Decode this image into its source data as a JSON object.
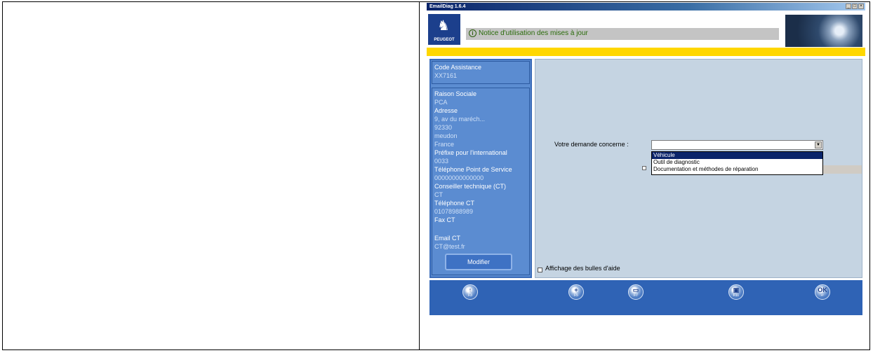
{
  "window": {
    "title": "EmailDiag 1.6.4",
    "controls": [
      "_",
      "□",
      "×"
    ]
  },
  "brand": {
    "logo_text": "PEUGEOT",
    "logo_icon": "peugeot-lion-icon"
  },
  "notice": {
    "icon": "info-icon",
    "icon_glyph": "i",
    "text": "Notice d'utilisation des mises à jour"
  },
  "sidebar": {
    "code_label": "Code Assistance",
    "code_value": "XX7161",
    "fields": [
      {
        "label": "Raison Sociale",
        "value": "PCA"
      },
      {
        "label": "Adresse",
        "value": "9, av du maréch..."
      },
      {
        "label": "",
        "value": "92330"
      },
      {
        "label": "",
        "value": "meudon"
      },
      {
        "label": "",
        "value": "France"
      },
      {
        "label": "Préfixe pour l'international",
        "value": "0033"
      },
      {
        "label": "Téléphone Point de Service",
        "value": "00000000000000"
      },
      {
        "label": "Conseiller technique (CT)",
        "value": "CT"
      },
      {
        "label": "Téléphone CT",
        "value": "01078988989"
      },
      {
        "label": "Fax CT",
        "value": ""
      },
      {
        "label": "Email CT",
        "value": "CT@test.fr"
      }
    ],
    "modify_button": "Modifier"
  },
  "form": {
    "request_label": "Votre demande concerne :",
    "select_value": "",
    "dropdown_options": [
      "Véhicule",
      "Outil de diagnostic",
      "Documentation et méthodes de réparation"
    ],
    "selected_index": 0,
    "help_checkbox_label": "Affichage des bulles d'aide",
    "help_checked": false
  },
  "toolbar": {
    "buttons": [
      {
        "icon": "upload-icon",
        "glyph": "↑",
        "key": "F3"
      },
      {
        "icon": "add-icon",
        "glyph": "+",
        "key": "F5"
      },
      {
        "icon": "attach-icon",
        "glyph": "▭",
        "key": "F7"
      },
      {
        "icon": "monitor-icon",
        "glyph": "▣",
        "key": "F11"
      },
      {
        "icon": "ok-icon",
        "glyph": "OK",
        "key": "↵"
      }
    ]
  },
  "colors": {
    "panel_blue": "#5b8cd1",
    "toolbar_blue": "#2f63b5",
    "banner_yellow": "#ffd700",
    "notice_green": "#2a6b0a",
    "form_bg": "#c5d4e2"
  }
}
